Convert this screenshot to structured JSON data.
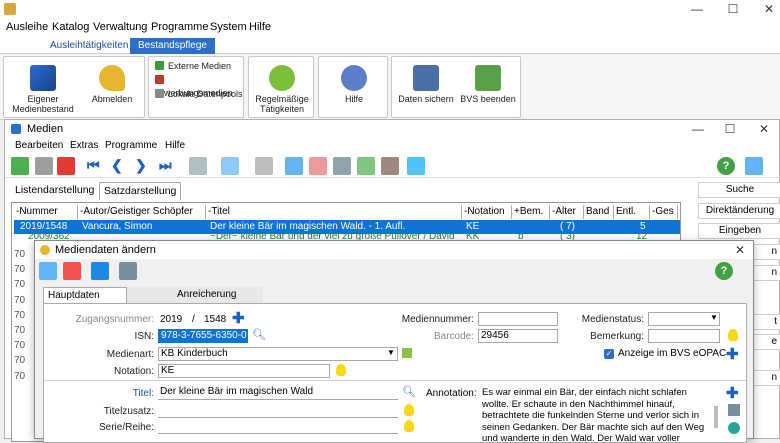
{
  "app": {
    "title": "",
    "window_controls": {
      "minimize": "—",
      "maximize": "☐",
      "close": "✕"
    }
  },
  "menubar": {
    "items": [
      "Ausleihe",
      "Katalog",
      "Verwaltung",
      "Programme",
      "System",
      "Hilfe"
    ]
  },
  "ribbon_tabs": [
    "Ausleihtätigkeiten",
    "Bestandspflege"
  ],
  "ribbon": {
    "eigener_medienbestand": "Eigener Medienbestand",
    "abmelden": "Abmelden",
    "externe_medien": "Externe Medien",
    "erwerbungsmedien": "Erwerbungsmedien",
    "lokale_datenpools": "Lokale Datenpools",
    "regelmaessige_taetigkeiten": "Regelmäßige Tätigkeiten",
    "hilfe": "Hilfe",
    "daten_sichern": "Daten sichern",
    "bvs_beenden": "BVS beenden"
  },
  "medien_window": {
    "title": "Medien",
    "menu": [
      "Bearbeiten",
      "Extras",
      "Programme",
      "Hilfe"
    ],
    "tabs": [
      "Listendarstellung",
      "Satzdarstellung"
    ],
    "columns": [
      "-Nummer",
      "-Autor/Geistiger Schöpfer",
      "-Titel",
      "-Notation",
      "+Bem.",
      "-Alter",
      "Band",
      "Entl.",
      "-Ges"
    ],
    "rows": [
      {
        "nummer": "2019/1548",
        "autor": "Vancura, Simon",
        "titel": "Der kleine Bär im magischen Wald. - 1. Aufl.",
        "notation": "KE",
        "bem": "",
        "alter": "( 7)",
        "band": "",
        "entl": "5",
        "ges": ""
      },
      {
        "nummer": "2009/362",
        "autor": "",
        "titel": "~Der~ kleine Bär und der viel zu große Pullover / David",
        "notation": "KK",
        "bem": "b",
        "alter": "( 3)",
        "band": "",
        "entl": "12",
        "ges": ""
      }
    ],
    "row_stubs": [
      "70",
      "70",
      "70",
      "70",
      "70",
      "70",
      "70",
      "70",
      "70"
    ],
    "side_buttons": [
      "Suche",
      "Direktänderung",
      "Eingeben",
      "n",
      "n",
      "t",
      "e",
      "n"
    ]
  },
  "dialog": {
    "title": "Mediendaten ändern",
    "tabs": [
      "Hauptdaten",
      "",
      "Anreicherung"
    ],
    "fields": {
      "zugangsnummer_label": "Zugangsnummer:",
      "zugang_jahr": "2019",
      "zugang_slash": "/",
      "zugang_nr": "1548",
      "isn_label": "ISN:",
      "isn_value": "978-3-7655-6350-0",
      "medienart_label": "Medienart:",
      "medienart_value": "KB  Kinderbuch",
      "notation_label": "Notation:",
      "notation_value": "KE",
      "mediennummer_label": "Mediennummer:",
      "mediennummer_value": "",
      "barcode_label": "Barcode:",
      "barcode_value": "29456",
      "medienstatus_label": "Medienstatus:",
      "medienstatus_value": "",
      "bemerkung_label": "Bemerkung:",
      "bemerkung_value": "",
      "opac_label": "Anzeige im BVS eOPAC",
      "titel_label": "Titel:",
      "titel_value": "Der kleine Bär im magischen Wald",
      "titelzusatz_label": "Titelzusatz:",
      "serie_label": "Serie/Reihe:",
      "annotation_label": "Annotation:",
      "annotation_text": "Es war einmal ein Bär, der einfach nicht schlafen wollte. Er schaute in den Nachthimmel hinauf, betrachtete die funkelnden Sterne und verlor sich in seinen Gedanken. Der Bär machte sich auf den Weg und wanderte in den Wald. Der Wald war voller Lebewesen, die alle schliefen."
    }
  },
  "colors": {
    "selection_blue": "#0b74d6",
    "ribbon_active": "#2d6ec9",
    "link_blue": "#1f4e9c"
  }
}
